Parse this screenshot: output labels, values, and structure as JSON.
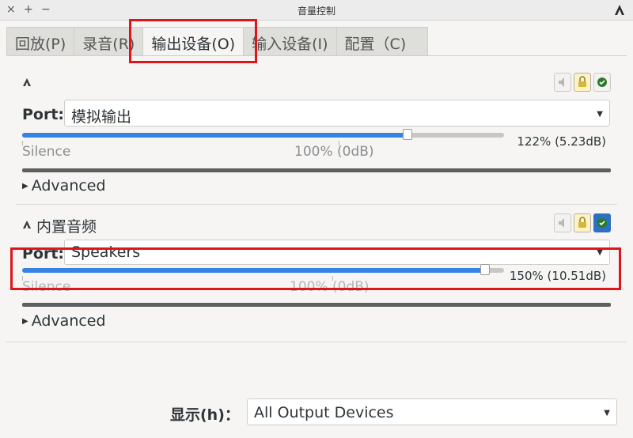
{
  "window": {
    "title": "音量控制",
    "close": "×",
    "maximize": "+",
    "minimize": "−"
  },
  "tabs": [
    {
      "label": "回放(P)",
      "active": false
    },
    {
      "label": "录音(R)",
      "active": false
    },
    {
      "label": "输出设备(O)",
      "active": true
    },
    {
      "label": "输入设备(I)",
      "active": false
    },
    {
      "label": "配置（C)",
      "active": false
    }
  ],
  "devices": [
    {
      "name": "",
      "port_label": "Port:",
      "port_value": "模拟输出",
      "volume_fraction": 0.8,
      "volume_text": "122% (5.23dB)",
      "silence_label": "Silence",
      "base_label": "100% (0dB)",
      "advanced_label": "Advanced"
    },
    {
      "name": "内置音频",
      "port_label": "Port:",
      "port_value": "Speakers",
      "volume_fraction": 0.96,
      "volume_text": "150% (10.51dB)",
      "silence_label": "Silence",
      "base_label": "100% (0dB)",
      "advanced_label": "Advanced"
    }
  ],
  "footer": {
    "show_label": "显示(h)：",
    "show_value": "All Output Devices"
  },
  "colors": {
    "accent": "#3584e4",
    "highlight": "#e0151b",
    "lock_bg": "#fff3c4"
  },
  "icons": [
    "speaker-icon",
    "mute-icon",
    "lock-icon",
    "default-check-icon",
    "chevron-down-icon"
  ]
}
